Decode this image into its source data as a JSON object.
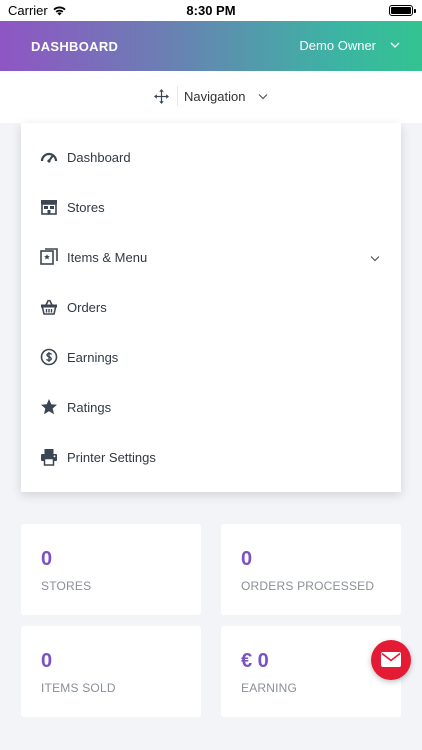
{
  "status_bar": {
    "carrier": "Carrier",
    "time": "8:30 PM"
  },
  "app_bar": {
    "title": "DASHBOARD",
    "user_menu_label": "Demo Owner"
  },
  "navigation": {
    "label": "Navigation"
  },
  "menu": {
    "items": [
      {
        "label": "Dashboard",
        "icon": "gauge-icon"
      },
      {
        "label": "Stores",
        "icon": "store-icon"
      },
      {
        "label": "Items & Menu",
        "icon": "menu-book-icon",
        "has_submenu": true
      },
      {
        "label": "Orders",
        "icon": "basket-icon"
      },
      {
        "label": "Earnings",
        "icon": "dollar-circle-icon"
      },
      {
        "label": "Ratings",
        "icon": "star-icon"
      },
      {
        "label": "Printer Settings",
        "icon": "printer-icon"
      }
    ]
  },
  "stats": [
    {
      "value": "0",
      "label": "STORES"
    },
    {
      "value": "0",
      "label": "ORDERS PROCESSED"
    },
    {
      "value": "0",
      "label": "ITEMS SOLD"
    },
    {
      "value": "€ 0",
      "label": "EARNING"
    }
  ],
  "colors": {
    "accent_purple": "#7b52c4",
    "gradient_start": "#8f55c4",
    "gradient_end": "#33c391",
    "fab_red": "#e31b35"
  },
  "fab": {
    "icon": "envelope-icon"
  }
}
